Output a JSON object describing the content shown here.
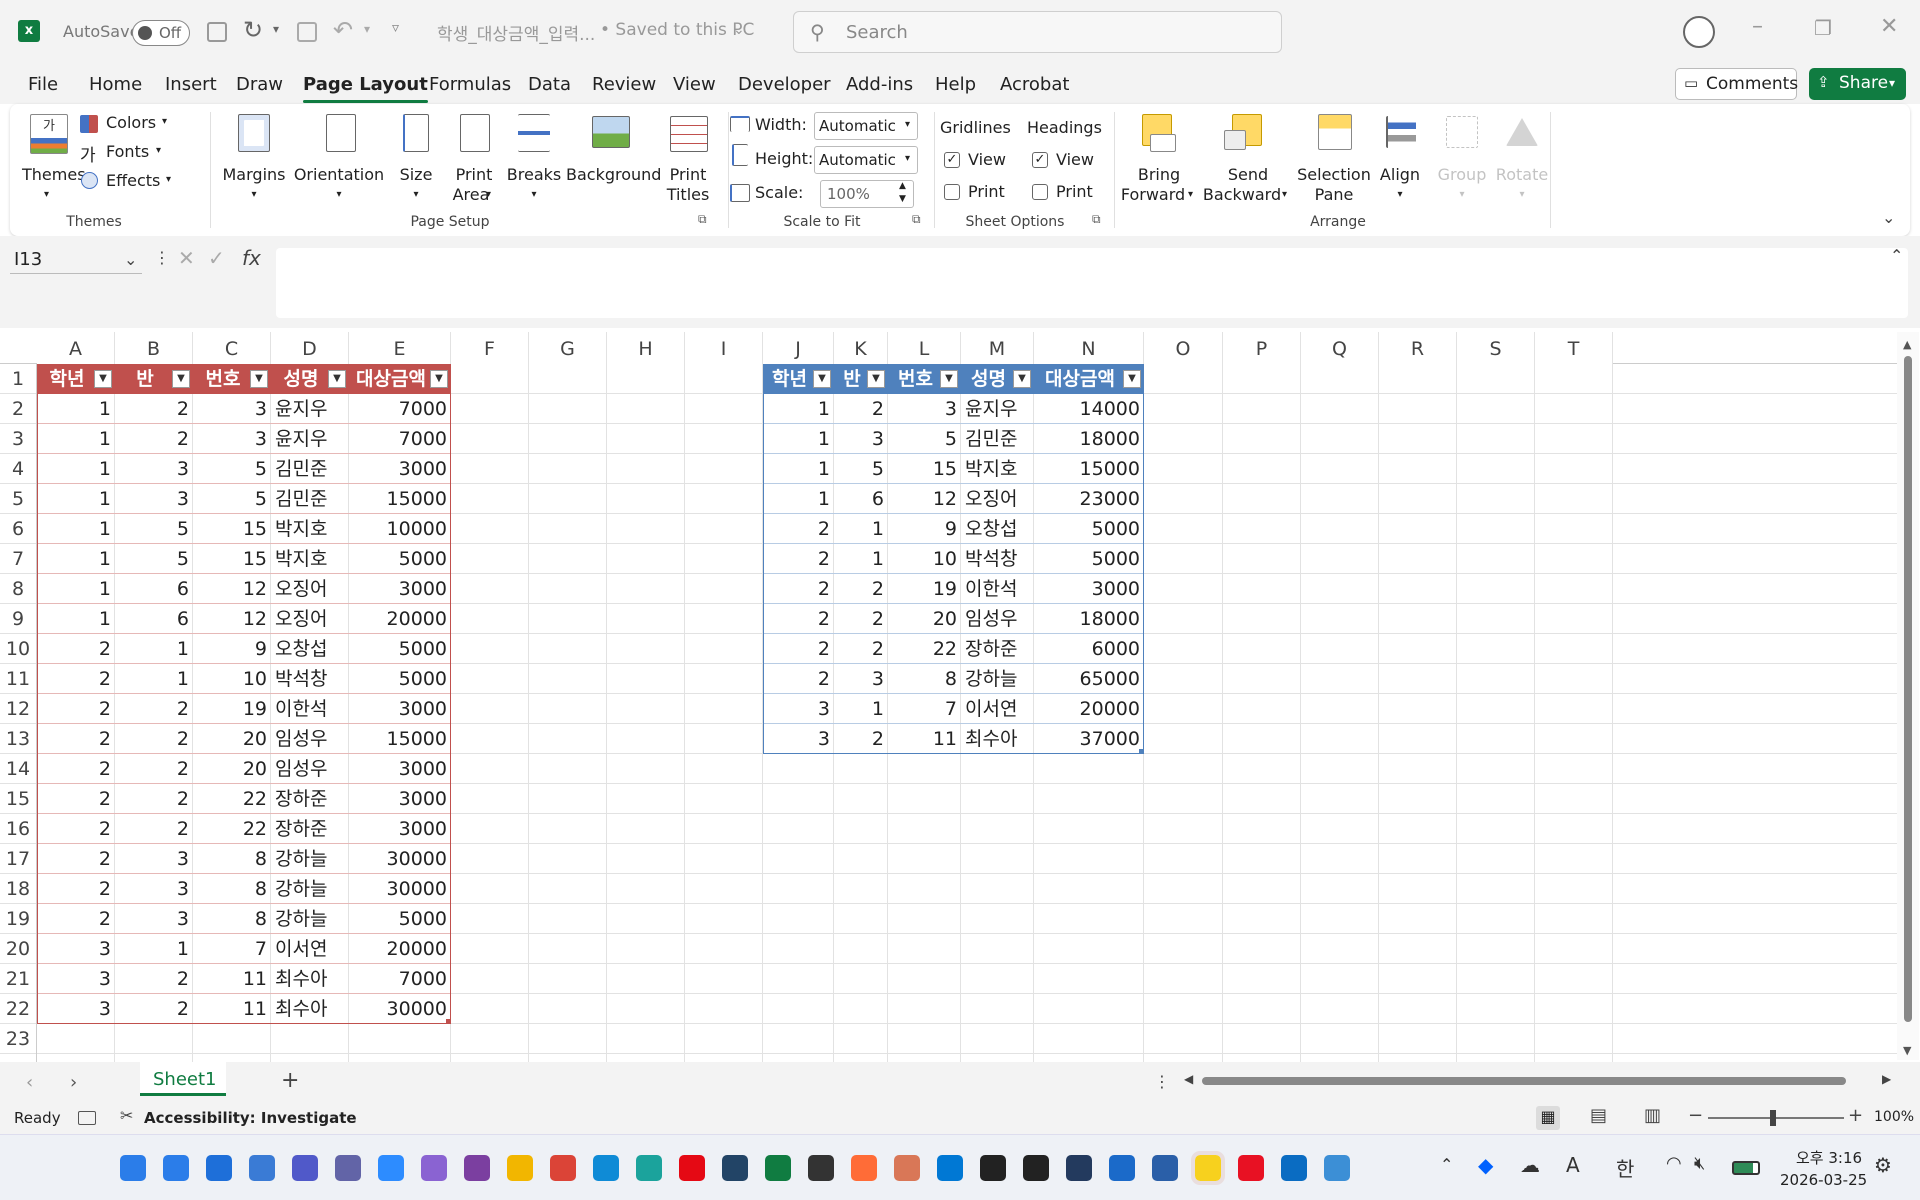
{
  "titlebar": {
    "autosave": "AutoSave",
    "autosave_state": "Off",
    "filename": "학생_대상금액_입력...",
    "save_status": "• Saved to this PC",
    "search_placeholder": "Search"
  },
  "menu": [
    "File",
    "Home",
    "Insert",
    "Draw",
    "Page Layout",
    "Formulas",
    "Data",
    "Review",
    "View",
    "Developer",
    "Add-ins",
    "Help",
    "Acrobat"
  ],
  "menu_active": "Page Layout",
  "actions": {
    "comments": "Comments",
    "share": "Share"
  },
  "ribbon": {
    "themes": {
      "themes": "Themes",
      "colors": "Colors",
      "fonts": "Fonts",
      "effects": "Effects",
      "group": "Themes"
    },
    "page_setup": {
      "margins": "Margins",
      "orientation": "Orientation",
      "size": "Size",
      "print_area_1": "Print",
      "print_area_2": "Area",
      "breaks": "Breaks",
      "background": "Background",
      "print_titles_1": "Print",
      "print_titles_2": "Titles",
      "group": "Page Setup"
    },
    "scale": {
      "width_label": "Width:",
      "width_value": "Automatic",
      "height_label": "Height:",
      "height_value": "Automatic",
      "scale_label": "Scale:",
      "scale_value": "100%",
      "group": "Scale to Fit"
    },
    "sheet_options": {
      "gridlines": "Gridlines",
      "headings": "Headings",
      "view": "View",
      "print": "Print",
      "group": "Sheet Options"
    },
    "arrange": {
      "bring_1": "Bring",
      "bring_2": "Forward",
      "send_1": "Send",
      "send_2": "Backward",
      "sel_1": "Selection",
      "sel_2": "Pane",
      "align": "Align",
      "group_btn": "Group",
      "rotate": "Rotate",
      "group": "Arrange"
    }
  },
  "formula": {
    "namebox": "I13",
    "fx": "fx",
    "value": ""
  },
  "columns": [
    "A",
    "B",
    "C",
    "D",
    "E",
    "F",
    "G",
    "H",
    "I",
    "J",
    "K",
    "L",
    "M",
    "N",
    "O",
    "P",
    "Q",
    "R",
    "S",
    "T"
  ],
  "rows": [
    "1",
    "2",
    "3",
    "4",
    "5",
    "6",
    "7",
    "8",
    "9",
    "10",
    "11",
    "12",
    "13",
    "14",
    "15",
    "16",
    "17",
    "18",
    "19",
    "20",
    "21",
    "22",
    "23"
  ],
  "table1": {
    "headers": [
      "학년",
      "반",
      "번호",
      "성명",
      "대상금액"
    ],
    "rows": [
      [
        "1",
        "2",
        "3",
        "윤지우",
        "7000"
      ],
      [
        "1",
        "2",
        "3",
        "윤지우",
        "7000"
      ],
      [
        "1",
        "3",
        "5",
        "김민준",
        "3000"
      ],
      [
        "1",
        "3",
        "5",
        "김민준",
        "15000"
      ],
      [
        "1",
        "5",
        "15",
        "박지호",
        "10000"
      ],
      [
        "1",
        "5",
        "15",
        "박지호",
        "5000"
      ],
      [
        "1",
        "6",
        "12",
        "오징어",
        "3000"
      ],
      [
        "1",
        "6",
        "12",
        "오징어",
        "20000"
      ],
      [
        "2",
        "1",
        "9",
        "오창섭",
        "5000"
      ],
      [
        "2",
        "1",
        "10",
        "박석창",
        "5000"
      ],
      [
        "2",
        "2",
        "19",
        "이한석",
        "3000"
      ],
      [
        "2",
        "2",
        "20",
        "임성우",
        "15000"
      ],
      [
        "2",
        "2",
        "20",
        "임성우",
        "3000"
      ],
      [
        "2",
        "2",
        "22",
        "장하준",
        "3000"
      ],
      [
        "2",
        "2",
        "22",
        "장하준",
        "3000"
      ],
      [
        "2",
        "3",
        "8",
        "강하늘",
        "30000"
      ],
      [
        "2",
        "3",
        "8",
        "강하늘",
        "30000"
      ],
      [
        "2",
        "3",
        "8",
        "강하늘",
        "5000"
      ],
      [
        "3",
        "1",
        "7",
        "이서연",
        "20000"
      ],
      [
        "3",
        "2",
        "11",
        "최수아",
        "7000"
      ],
      [
        "3",
        "2",
        "11",
        "최수아",
        "30000"
      ]
    ]
  },
  "table2": {
    "headers": [
      "학년",
      "반",
      "번호",
      "성명",
      "대상금액"
    ],
    "rows": [
      [
        "1",
        "2",
        "3",
        "윤지우",
        "14000"
      ],
      [
        "1",
        "3",
        "5",
        "김민준",
        "18000"
      ],
      [
        "1",
        "5",
        "15",
        "박지호",
        "15000"
      ],
      [
        "1",
        "6",
        "12",
        "오징어",
        "23000"
      ],
      [
        "2",
        "1",
        "9",
        "오창섭",
        "5000"
      ],
      [
        "2",
        "1",
        "10",
        "박석창",
        "5000"
      ],
      [
        "2",
        "2",
        "19",
        "이한석",
        "3000"
      ],
      [
        "2",
        "2",
        "20",
        "임성우",
        "18000"
      ],
      [
        "2",
        "2",
        "22",
        "장하준",
        "6000"
      ],
      [
        "2",
        "3",
        "8",
        "강하늘",
        "65000"
      ],
      [
        "3",
        "1",
        "7",
        "이서연",
        "20000"
      ],
      [
        "3",
        "2",
        "11",
        "최수아",
        "37000"
      ]
    ]
  },
  "sheet": {
    "tab": "Sheet1",
    "add": "+"
  },
  "status": {
    "ready": "Ready",
    "accessibility": "Accessibility: Investigate",
    "zoom": "100%"
  },
  "taskbar": {
    "time": "오후 3:16",
    "date": "2026-03-25",
    "ime": "한"
  },
  "colors": {
    "table1_header": "#c0504d",
    "table2_header": "#4f81bd",
    "excel_green": "#107c41"
  }
}
